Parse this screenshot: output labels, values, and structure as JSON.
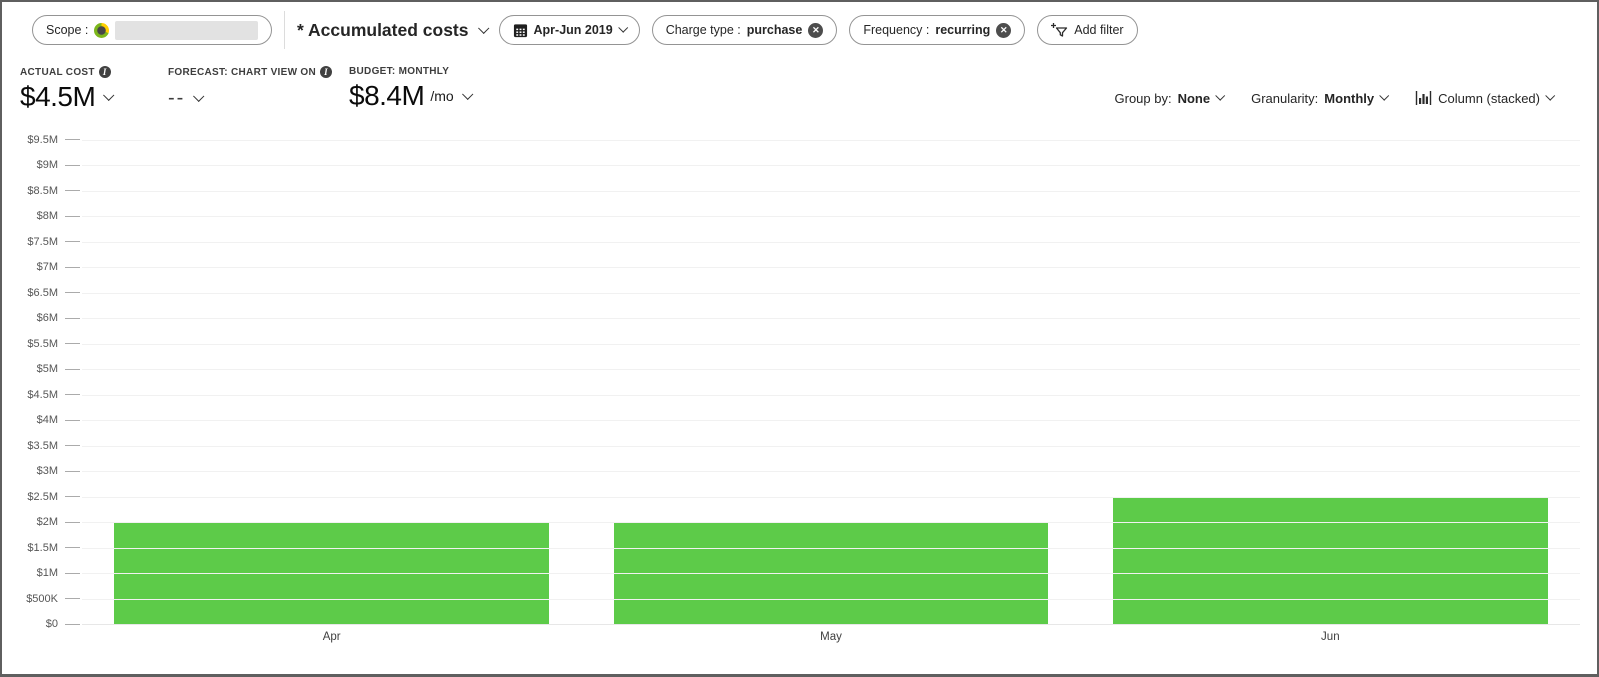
{
  "toolbar": {
    "scope_label": "Scope :",
    "view_title": "* Accumulated costs",
    "date_range": "Apr-Jun 2019",
    "filters": [
      {
        "label": "Charge type :",
        "value": "purchase"
      },
      {
        "label": "Frequency :",
        "value": "recurring"
      }
    ],
    "add_filter_label": "Add filter"
  },
  "kpis": {
    "actual": {
      "label": "ACTUAL COST",
      "value": "$4.5M"
    },
    "forecast": {
      "label": "FORECAST: CHART VIEW ON",
      "value": "--"
    },
    "budget": {
      "label": "BUDGET: MONTHLY",
      "value": "$8.4M",
      "suffix": "/mo"
    }
  },
  "chart_controls": {
    "group_by_label": "Group by:",
    "group_by_value": "None",
    "granularity_label": "Granularity:",
    "granularity_value": "Monthly",
    "chart_type": "Column (stacked)"
  },
  "chart_data": {
    "type": "bar",
    "title": "Accumulated costs",
    "categories": [
      "Apr",
      "May",
      "Jun"
    ],
    "values": [
      2000000,
      2000000,
      2500000
    ],
    "series": [
      {
        "name": "Actual cost",
        "values": [
          2000000,
          2000000,
          2500000
        ]
      }
    ],
    "xlabel": "",
    "ylabel": "",
    "ylim": [
      0,
      9750000
    ],
    "ytick_step": 500000,
    "ytick_labels": [
      "$0",
      "$500K",
      "$1M",
      "$1.5M",
      "$2M",
      "$2.5M",
      "$3M",
      "$3.5M",
      "$4M",
      "$4.5M",
      "$5M",
      "$5.5M",
      "$6M",
      "$6.5M",
      "$7M",
      "$7.5M",
      "$8M",
      "$8.5M",
      "$9M",
      "$9.5M"
    ],
    "bar_color": "#5DCB49",
    "grid": true,
    "legend": false
  }
}
